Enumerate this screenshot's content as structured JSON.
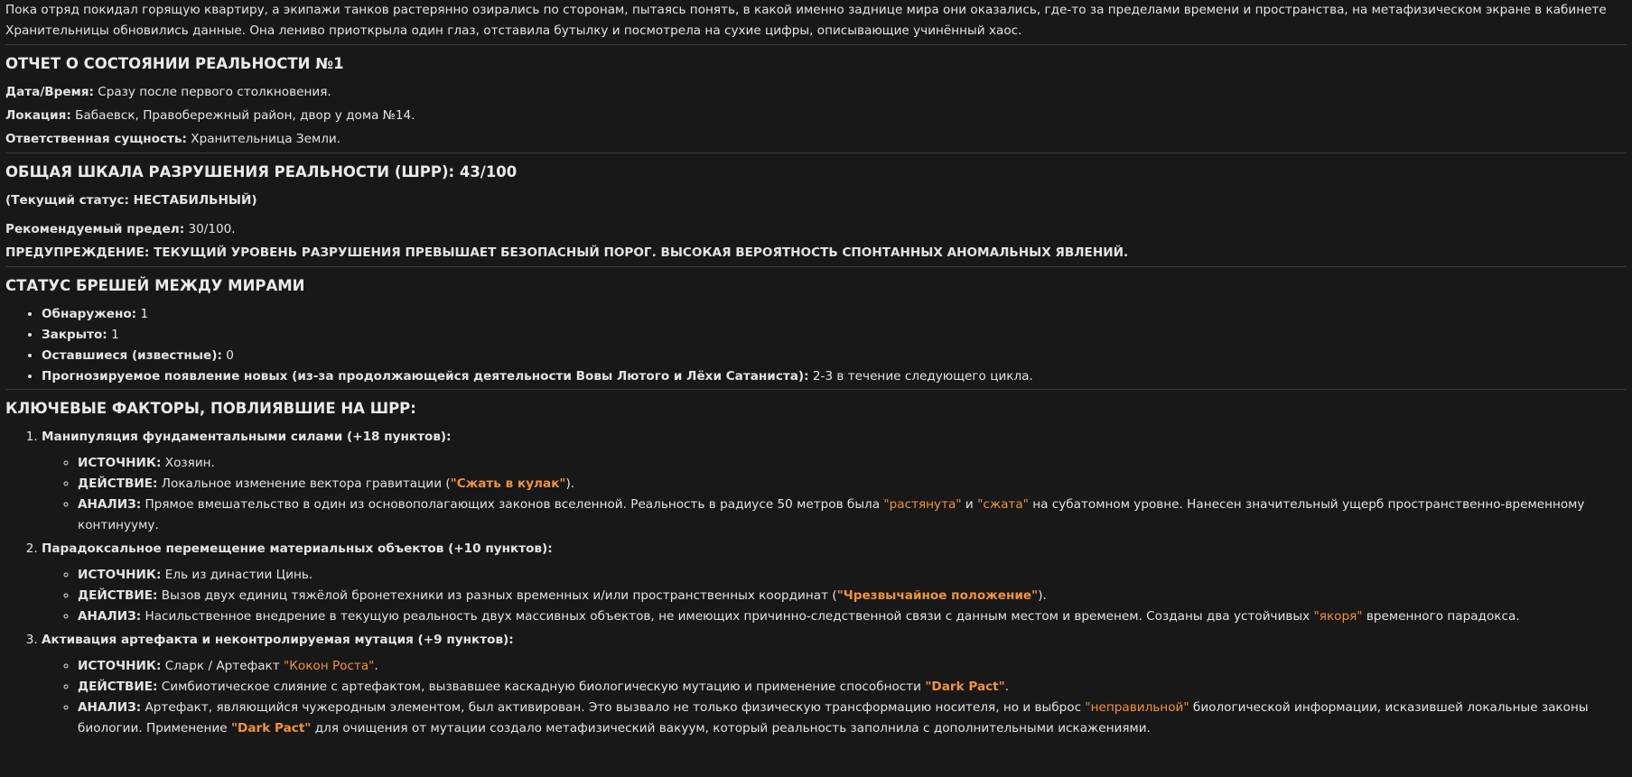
{
  "intro": "Пока отряд покидал горящую квартиру, а экипажи танков растерянно озирались по сторонам, пытаясь понять, в какой именно заднице мира они оказались, где-то за пределами времени и пространства, на метафизическом экране в кабинете Хранительницы обновились данные. Она лениво приоткрыла один глаз, отставила бутылку и посмотрела на сухие цифры, описывающие учинённый хаос.",
  "report": {
    "title": "ОТЧЕТ О СОСТОЯНИИ РЕАЛЬНОСТИ №1",
    "date_label": "Дата/Время:",
    "date_value": " Сразу после первого столкновения.",
    "location_label": "Локация:",
    "location_value": " Бабаевск, Правобережный район, двор у дома №14.",
    "entity_label": "Ответственная сущность:",
    "entity_value": " Хранительница Земли."
  },
  "scale": {
    "title": "ОБЩАЯ ШКАЛА РАЗРУШЕНИЯ РЕАЛЬНОСТИ (ШРР): 43/100",
    "status": "(Текущий статус: НЕСТАБИЛЬНЫЙ)",
    "limit_label": "Рекомендуемый предел:",
    "limit_value": " 30/100.",
    "warning": "ПРЕДУПРЕЖДЕНИЕ: ТЕКУЩИЙ УРОВЕНЬ РАЗРУШЕНИЯ ПРЕВЫШАЕТ БЕЗОПАСНЫЙ ПОРОГ. ВЫСОКАЯ ВЕРОЯТНОСТЬ СПОНТАННЫХ АНОМАЛЬНЫХ ЯВЛЕНИЙ."
  },
  "breaches": {
    "title": "СТАТУС БРЕШЕЙ МЕЖДУ МИРАМИ",
    "items": [
      {
        "label": "Обнаружено:",
        "value": " 1"
      },
      {
        "label": "Закрыто:",
        "value": " 1"
      },
      {
        "label": "Оставшиеся (известные):",
        "value": " 0"
      },
      {
        "label": "Прогнозируемое появление новых (из-за продолжающейся деятельности Вовы Лютого и Лёхи Сатаниста):",
        "value": " 2-3 в течение следующего цикла."
      }
    ]
  },
  "factors": {
    "title": "КЛЮЧЕВЫЕ ФАКТОРЫ, ПОВЛИЯВШИЕ НА ШРР:",
    "source_label": "ИСТОЧНИК:",
    "action_label": "ДЕЙСТВИЕ:",
    "analysis_label": "АНАЛИЗ:",
    "f1": {
      "title": "Манипуляция фундаментальными силами (+18 пунктов):",
      "source": " Хозяин.",
      "action_pre": " Локальное изменение вектора гравитации (",
      "action_hl": "\"Сжать в кулак\"",
      "action_post": ").",
      "analysis_pre": " Прямое вмешательство в один из основополагающих законов вселенной. Реальность в радиусе 50 метров была ",
      "analysis_hl1": "\"растянута\"",
      "analysis_mid": " и ",
      "analysis_hl2": "\"сжата\"",
      "analysis_post": " на субатомном уровне. Нанесен значительный ущерб пространственно-временному континууму."
    },
    "f2": {
      "title": "Парадоксальное перемещение материальных объектов (+10 пунктов):",
      "source": " Ель из династии Цинь.",
      "action_pre": " Вызов двух единиц тяжёлой бронетехники из разных временных и/или пространственных координат (",
      "action_hl": "\"Чрезвычайное положение\"",
      "action_post": ").",
      "analysis_pre": " Насильственное внедрение в текущую реальность двух массивных объектов, не имеющих причинно-следственной связи с данным местом и временем. Созданы два устойчивых ",
      "analysis_hl": "\"якоря\"",
      "analysis_post": " временного парадокса."
    },
    "f3": {
      "title": "Активация артефакта и неконтролируемая мутация (+9 пунктов):",
      "source_pre": " Сларк / Артефакт ",
      "source_hl": "\"Кокон Роста\"",
      "source_post": ".",
      "action_pre": " Симбиотическое слияние с артефактом, вызвавшее каскадную биологическую мутацию и применение способности ",
      "action_hl": "\"Dark Pact\"",
      "action_post": ".",
      "analysis_pre": " Артефакт, являющийся чужеродным элементом, был активирован. Это вызвало не только физическую трансформацию носителя, но и выброс ",
      "analysis_hl1": "\"неправильной\"",
      "analysis_mid": " биологической информации, исказившей локальные законы биологии. Применение ",
      "analysis_hl2": "\"Dark Pact\"",
      "analysis_post": " для очищения от мутации создало метафизический вакуум, который реальность заполнила с дополнительными искажениями."
    }
  }
}
